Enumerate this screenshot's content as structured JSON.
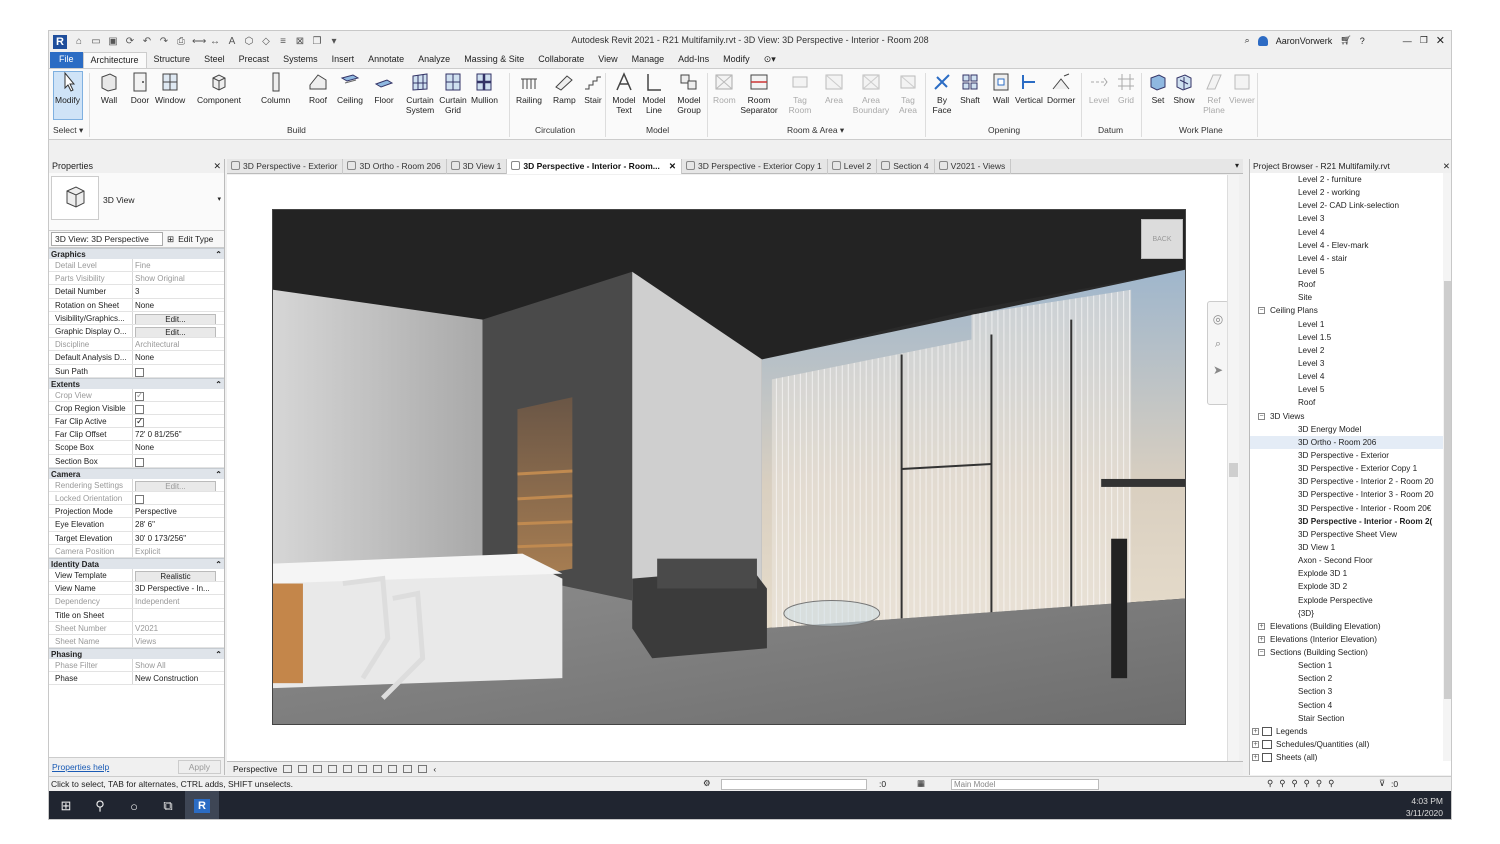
{
  "window": {
    "title": "Autodesk Revit 2021 - R21 Multifamily.rvt - 3D View: 3D Perspective - Interior - Room 208",
    "user": "AaronVorwerk"
  },
  "tabs": [
    "File",
    "Architecture",
    "Structure",
    "Steel",
    "Precast",
    "Systems",
    "Insert",
    "Annotate",
    "Analyze",
    "Massing & Site",
    "Collaborate",
    "View",
    "Manage",
    "Add-Ins",
    "Modify"
  ],
  "ribbon": {
    "buttons": {
      "modify": "Modify",
      "wall": "Wall",
      "door": "Door",
      "window": "Window",
      "component": "Component",
      "column": "Column",
      "roof": "Roof",
      "ceiling": "Ceiling",
      "floor": "Floor",
      "curtain_system": "Curtain System",
      "curtain_grid": "Curtain Grid",
      "mullion": "Mullion",
      "railing": "Railing",
      "ramp": "Ramp",
      "stair": "Stair",
      "model_text": "Model Text",
      "model_line": "Model Line",
      "model_group": "Model Group",
      "room": "Room",
      "room_separator": "Room Separator",
      "tag_room": "Tag Room",
      "area": "Area",
      "area_boundary": "Area Boundary",
      "tag_area": "Tag Area",
      "by_face": "By Face",
      "shaft": "Shaft",
      "wall_op": "Wall",
      "vertical": "Vertical",
      "dormer": "Dormer",
      "level": "Level",
      "grid": "Grid",
      "set": "Set",
      "show": "Show",
      "ref_plane": "Ref Plane",
      "viewer": "Viewer"
    },
    "panels": {
      "select": "Select ▾",
      "build": "Build",
      "circulation": "Circulation",
      "model": "Model",
      "room_area": "Room & Area ▾",
      "opening": "Opening",
      "datum": "Datum",
      "work_plane": "Work Plane"
    }
  },
  "properties": {
    "title": "Properties",
    "type_name": "3D View",
    "filter": "3D View: 3D Perspective",
    "edit_type": "Edit Type",
    "groups": [
      {
        "name": "Graphics",
        "rows": [
          {
            "k": "Detail Level",
            "v": "Fine",
            "g": true
          },
          {
            "k": "Parts Visibility",
            "v": "Show Original",
            "g": true
          },
          {
            "k": "Detail Number",
            "v": "3"
          },
          {
            "k": "Rotation on Sheet",
            "v": "None"
          },
          {
            "k": "Visibility/Graphics...",
            "v": "Edit...",
            "btn": true
          },
          {
            "k": "Graphic Display O...",
            "v": "Edit...",
            "btn": true
          },
          {
            "k": "Discipline",
            "v": "Architectural",
            "g": true
          },
          {
            "k": "Default Analysis D...",
            "v": "None"
          },
          {
            "k": "Sun Path",
            "v": "",
            "cb": "off"
          }
        ]
      },
      {
        "name": "Extents",
        "rows": [
          {
            "k": "Crop View",
            "v": "",
            "cb": "on",
            "g": true
          },
          {
            "k": "Crop Region Visible",
            "v": "",
            "cb": "off"
          },
          {
            "k": "Far Clip Active",
            "v": "",
            "cb": "on"
          },
          {
            "k": "Far Clip Offset",
            "v": "72'  0 81/256\""
          },
          {
            "k": "Scope Box",
            "v": "None"
          },
          {
            "k": "Section Box",
            "v": "",
            "cb": "off"
          }
        ]
      },
      {
        "name": "Camera",
        "rows": [
          {
            "k": "Rendering Settings",
            "v": "Edit...",
            "btn": true,
            "g": true
          },
          {
            "k": "Locked Orientation",
            "v": "",
            "cb": "off",
            "g": true
          },
          {
            "k": "Projection Mode",
            "v": "Perspective"
          },
          {
            "k": "Eye Elevation",
            "v": "28'  6\""
          },
          {
            "k": "Target Elevation",
            "v": "30'  0 173/256\""
          },
          {
            "k": "Camera Position",
            "v": "Explicit",
            "g": true
          }
        ]
      },
      {
        "name": "Identity Data",
        "rows": [
          {
            "k": "View Template",
            "v": "Realistic",
            "btn": true
          },
          {
            "k": "View Name",
            "v": "3D Perspective - In..."
          },
          {
            "k": "Dependency",
            "v": "Independent",
            "g": true
          },
          {
            "k": "Title on Sheet",
            "v": ""
          },
          {
            "k": "Sheet Number",
            "v": "V2021",
            "g": true
          },
          {
            "k": "Sheet Name",
            "v": "Views",
            "g": true
          }
        ]
      },
      {
        "name": "Phasing",
        "rows": [
          {
            "k": "Phase Filter",
            "v": "Show All",
            "g": true
          },
          {
            "k": "Phase",
            "v": "New Construction"
          }
        ]
      }
    ],
    "help": "Properties help",
    "apply": "Apply"
  },
  "view_tabs": [
    "3D Perspective - Exterior",
    "3D Ortho - Room 206",
    "3D View 1",
    "3D Perspective - Interior - Room...",
    "3D Perspective - Exterior Copy 1",
    "Level 2",
    "Section 4",
    "V2021 - Views"
  ],
  "view_control": {
    "mode": "Perspective"
  },
  "viewcube": "BACK",
  "project_browser": {
    "title": "Project Browser - R21 Multifamily.rvt",
    "items": [
      {
        "t": "Level 2 - furniture",
        "l": 2
      },
      {
        "t": "Level 2 - working",
        "l": 2
      },
      {
        "t": "Level 2- CAD Link-selection",
        "l": 2
      },
      {
        "t": "Level 3",
        "l": 2
      },
      {
        "t": "Level 4",
        "l": 2
      },
      {
        "t": "Level 4 - Elev-mark",
        "l": 2
      },
      {
        "t": "Level 4 - stair",
        "l": 2
      },
      {
        "t": "Level 5",
        "l": 2
      },
      {
        "t": "Roof",
        "l": 2
      },
      {
        "t": "Site",
        "l": 2
      },
      {
        "t": "Ceiling Plans",
        "l": 1,
        "tog": "−"
      },
      {
        "t": "Level 1",
        "l": 2
      },
      {
        "t": "Level 1.5",
        "l": 2
      },
      {
        "t": "Level 2",
        "l": 2
      },
      {
        "t": "Level 3",
        "l": 2
      },
      {
        "t": "Level 4",
        "l": 2
      },
      {
        "t": "Level 5",
        "l": 2
      },
      {
        "t": "Roof",
        "l": 2
      },
      {
        "t": "3D Views",
        "l": 1,
        "tog": "−"
      },
      {
        "t": "3D Energy Model",
        "l": 2
      },
      {
        "t": "3D Ortho - Room 206",
        "l": 2,
        "sel": true
      },
      {
        "t": "3D Perspective - Exterior",
        "l": 2
      },
      {
        "t": "3D Perspective - Exterior Copy 1",
        "l": 2
      },
      {
        "t": "3D Perspective - Interior 2 - Room 20",
        "l": 2
      },
      {
        "t": "3D Perspective - Interior 3 - Room 20",
        "l": 2
      },
      {
        "t": "3D Perspective - Interior - Room 20€",
        "l": 2
      },
      {
        "t": "3D Perspective - Interior - Room 2(",
        "l": 2,
        "bold": true
      },
      {
        "t": "3D Perspective Sheet View",
        "l": 2
      },
      {
        "t": "3D View 1",
        "l": 2
      },
      {
        "t": "Axon - Second Floor",
        "l": 2
      },
      {
        "t": "Explode 3D 1",
        "l": 2
      },
      {
        "t": "Explode 3D 2",
        "l": 2
      },
      {
        "t": "Explode Perspective",
        "l": 2
      },
      {
        "t": "{3D}",
        "l": 2
      },
      {
        "t": "Elevations (Building Elevation)",
        "l": 1,
        "tog": "+"
      },
      {
        "t": "Elevations (Interior Elevation)",
        "l": 1,
        "tog": "+"
      },
      {
        "t": "Sections (Building Section)",
        "l": 1,
        "tog": "−"
      },
      {
        "t": "Section 1",
        "l": 2
      },
      {
        "t": "Section 2",
        "l": 2
      },
      {
        "t": "Section 3",
        "l": 2
      },
      {
        "t": "Section 4",
        "l": 2
      },
      {
        "t": "Stair Section",
        "l": 2
      },
      {
        "t": "Legends",
        "l": 0,
        "tog": "+"
      },
      {
        "t": "Schedules/Quantities (all)",
        "l": 0,
        "tog": "+"
      },
      {
        "t": "Sheets (all)",
        "l": 0,
        "tog": "+"
      }
    ]
  },
  "status": {
    "hint": "Click to select, TAB for alternates, CTRL adds, SHIFT unselects.",
    "zero1": ":0",
    "model": "Main Model",
    "zero2": ":0"
  },
  "clock": {
    "time": "4:03 PM",
    "date": "3/11/2020"
  }
}
